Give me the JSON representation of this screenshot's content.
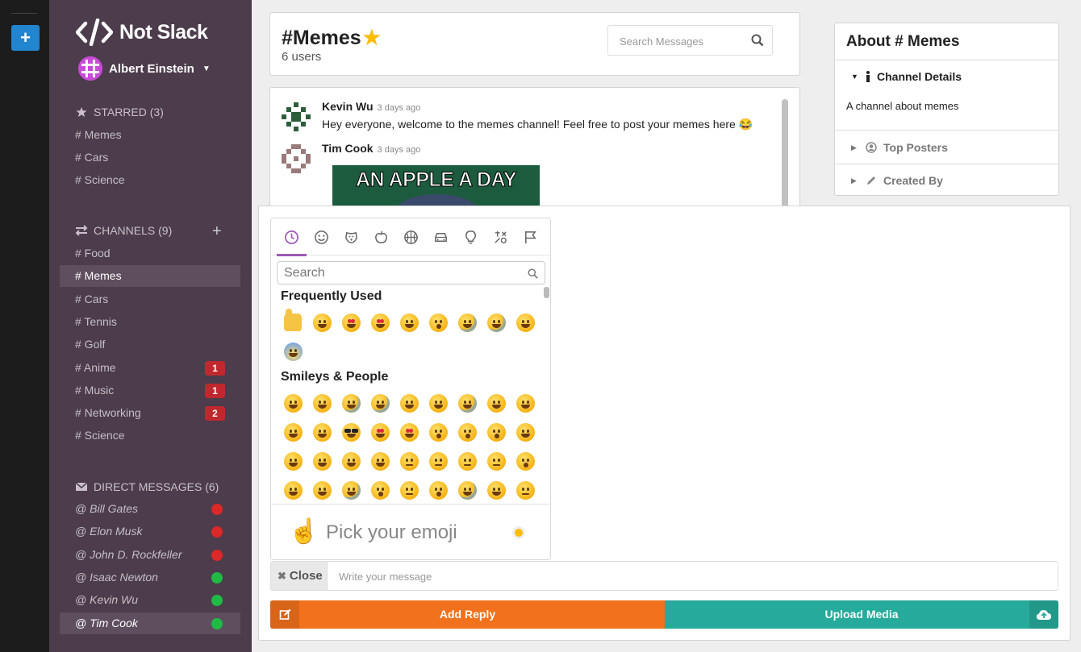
{
  "app": {
    "name": "Not Slack",
    "user": "Albert Einstein"
  },
  "sidebar": {
    "starred": {
      "title": "STARRED (3)",
      "items": [
        "# Memes",
        "# Cars",
        "# Science"
      ]
    },
    "channels": {
      "title": "CHANNELS (9)",
      "items": [
        {
          "label": "# Food",
          "badge": ""
        },
        {
          "label": "# Memes",
          "badge": "",
          "active": true
        },
        {
          "label": "# Cars",
          "badge": ""
        },
        {
          "label": "# Tennis",
          "badge": ""
        },
        {
          "label": "# Golf",
          "badge": ""
        },
        {
          "label": "# Anime",
          "badge": "1"
        },
        {
          "label": "# Music",
          "badge": "1"
        },
        {
          "label": "# Networking",
          "badge": "2"
        },
        {
          "label": "# Science",
          "badge": ""
        }
      ]
    },
    "direct": {
      "title": "DIRECT MESSAGES (6)",
      "items": [
        {
          "label": "@ Bill Gates",
          "status": "offline"
        },
        {
          "label": "@ Elon Musk",
          "status": "offline"
        },
        {
          "label": "@ John D. Rockfeller",
          "status": "offline"
        },
        {
          "label": "@ Isaac Newton",
          "status": "online"
        },
        {
          "label": "@ Kevin Wu",
          "status": "online"
        },
        {
          "label": "@ Tim Cook",
          "status": "online",
          "active": true
        }
      ]
    }
  },
  "colors": {
    "online": "#21ba45",
    "offline": "#db2828",
    "accent": "#2185d0",
    "reply": "#f2711c",
    "upload": "#26aa9b",
    "tab_active": "#9b59b6"
  },
  "header": {
    "channel": "#Memes",
    "users": "6 users",
    "search_placeholder": "Search Messages"
  },
  "messages": [
    {
      "author": "Kevin Wu",
      "time": "3 days ago",
      "text": "Hey everyone, welcome to the memes channel! Feel free to post your memes here 😂"
    },
    {
      "author": "Tim Cook",
      "time": "3 days ago",
      "image_caption": "AN APPLE A DAY"
    }
  ],
  "about": {
    "title": "About # Memes",
    "details_label": "Channel Details",
    "description": "A channel about memes",
    "top_posters_label": "Top Posters",
    "created_by_label": "Created By"
  },
  "emoji_picker": {
    "search_placeholder": "Search",
    "frequently_used_label": "Frequently Used",
    "smileys_label": "Smileys & People",
    "footer_text": "Pick your emoji",
    "tabs": [
      "recent-icon",
      "smiley-icon",
      "animal-icon",
      "food-icon",
      "activity-icon",
      "travel-icon",
      "objects-icon",
      "symbols-icon",
      "flags-icon"
    ],
    "frequently_used_count": 10,
    "smileys_count": 36
  },
  "compose": {
    "close_label": "Close",
    "message_placeholder": "Write your message",
    "reply_label": "Add Reply",
    "upload_label": "Upload Media"
  }
}
